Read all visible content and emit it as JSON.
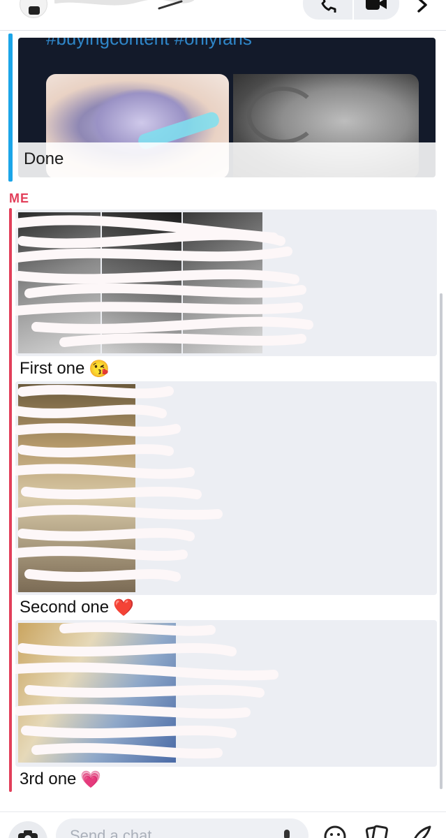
{
  "header": {
    "avatar_icon": "bitmoji-avatar-icon",
    "icons": [
      "phone-icon",
      "video-icon",
      "chevron-right-icon"
    ]
  },
  "shared_post": {
    "hashtags": "#buyingcontent #onlyfans",
    "caption": "Done",
    "accent_color": "#1ba5e8"
  },
  "conversation": {
    "sender_label": "ME",
    "sender_color": "#e23f5a",
    "messages": [
      {
        "caption": "First one",
        "emoji": "😘"
      },
      {
        "caption": "Second one",
        "emoji": "❤️"
      },
      {
        "caption": "3rd one",
        "emoji": "💗"
      }
    ]
  },
  "composer": {
    "placeholder": "Send a chat",
    "icons": [
      "camera-icon",
      "mic-icon",
      "smile-icon",
      "sticker-icon",
      "rocket-icon"
    ]
  }
}
